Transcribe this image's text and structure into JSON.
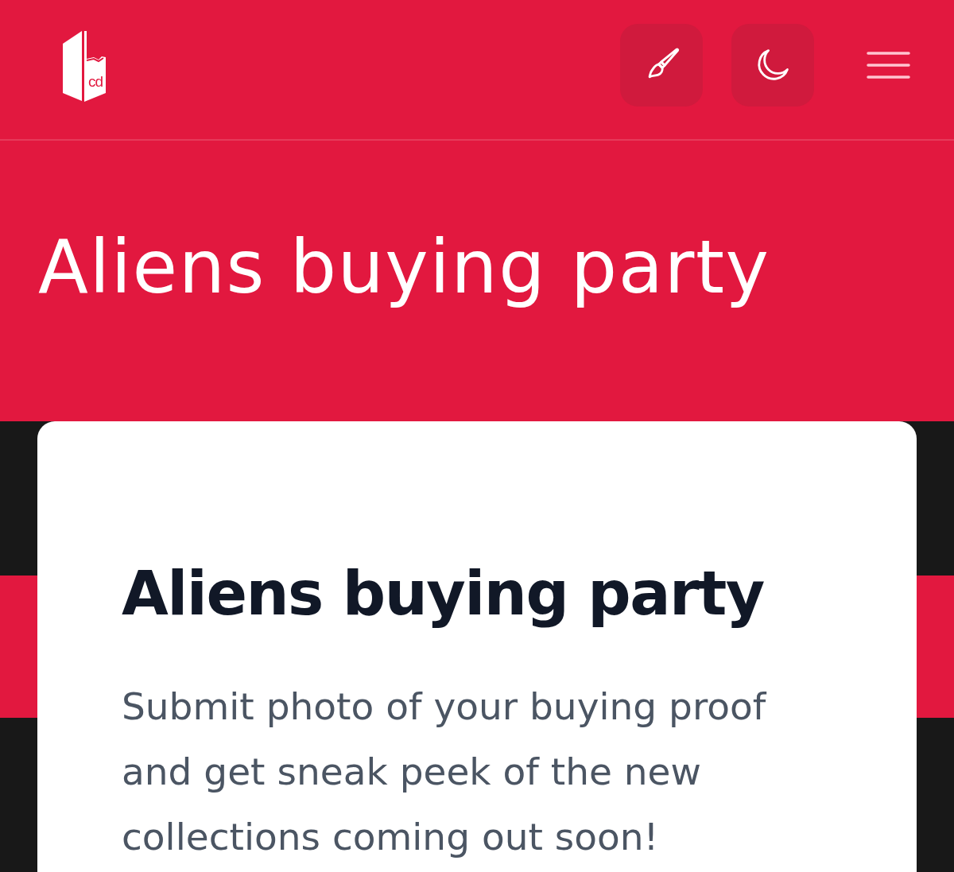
{
  "header": {
    "logo_text": "cd"
  },
  "hero": {
    "title": "Aliens buying party"
  },
  "card": {
    "title": "Aliens buying party",
    "description": "Submit photo of your buying proof and get sneak peek of the new collections coming out soon!"
  }
}
